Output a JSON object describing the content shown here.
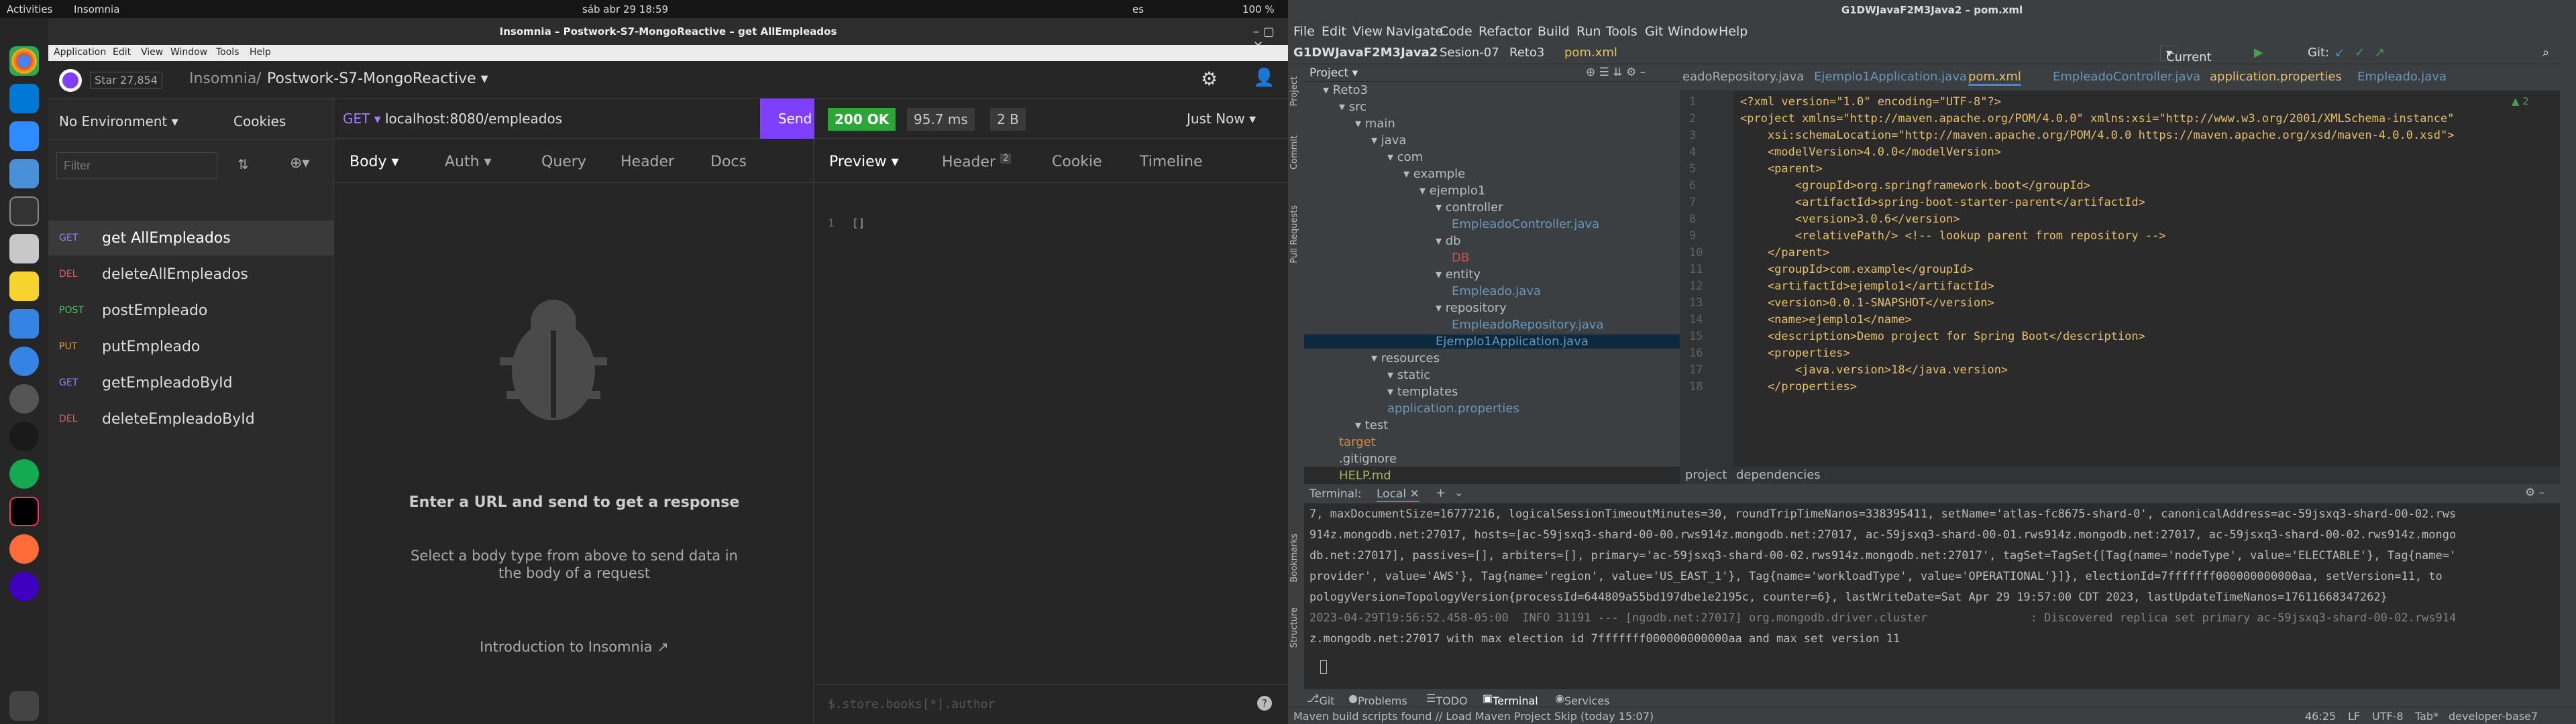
{
  "topbar": {
    "activities": "Activities",
    "app": "Insomnia",
    "clock": "sáb abr 29  18:59",
    "lang": "es",
    "battery": "100 %"
  },
  "insomnia": {
    "window_title": "Insomnia – Postwork-S7-MongoReactive – get AllEmpleados",
    "menu": [
      "Application",
      "Edit",
      "View",
      "Window",
      "Tools",
      "Help"
    ],
    "star": "Star",
    "star_count": "27,854",
    "breadcrumb_root": "Insomnia",
    "project": "Postwork-S7-MongoReactive",
    "env": "No Environment",
    "cookies": "Cookies",
    "filter_placeholder": "Filter",
    "requests": [
      {
        "method": "GET",
        "name": "get AllEmpleados"
      },
      {
        "method": "DEL",
        "name": "deleteAllEmpleados"
      },
      {
        "method": "POST",
        "name": "postEmpleado"
      },
      {
        "method": "PUT",
        "name": "putEmpleado"
      },
      {
        "method": "GET",
        "name": "getEmpleadoById"
      },
      {
        "method": "DEL",
        "name": "deleteEmpleadoById"
      }
    ],
    "url_method": "GET",
    "url": "localhost:8080/empleados",
    "send": "Send",
    "req_tabs": [
      "Body",
      "Auth",
      "Query",
      "Header",
      "Docs"
    ],
    "empty_title": "Enter a URL and send to get a response",
    "empty_sub1": "Select a body type from above to send data in",
    "empty_sub2": "the body of a request",
    "intro_link": "Introduction to Insomnia",
    "status": "200 OK",
    "time": "95.7 ms",
    "size": "2 B",
    "when": "Just Now",
    "resp_tabs": [
      "Preview",
      "Header",
      "Cookie",
      "Timeline"
    ],
    "header_count": "2",
    "body_line": "1",
    "body_text": "[]",
    "filter_expr": "$.store.books[*].author",
    "help": "?"
  },
  "ide": {
    "title": "G1DWJavaF2M3Java2 – pom.xml",
    "menu": [
      "File",
      "Edit",
      "View",
      "Navigate",
      "Code",
      "Refactor",
      "Build",
      "Run",
      "Tools",
      "Git",
      "Window",
      "Help"
    ],
    "nav": [
      "G1DWJavaF2M3Java2",
      "Sesion-07",
      "Reto3",
      "pom.xml"
    ],
    "run_config": "Current File",
    "git": "Git:",
    "project_label": "Project",
    "tree": [
      {
        "t": "Reto3",
        "d": 2,
        "c": ""
      },
      {
        "t": "src",
        "d": 3,
        "c": ""
      },
      {
        "t": "main",
        "d": 4,
        "c": ""
      },
      {
        "t": "java",
        "d": 5,
        "c": ""
      },
      {
        "t": "com",
        "d": 6,
        "c": ""
      },
      {
        "t": "example",
        "d": 7,
        "c": ""
      },
      {
        "t": "ejemplo1",
        "d": 8,
        "c": ""
      },
      {
        "t": "controller",
        "d": 9,
        "c": ""
      },
      {
        "t": "EmpleadoController.java",
        "d": 10,
        "c": "java"
      },
      {
        "t": "db",
        "d": 9,
        "c": ""
      },
      {
        "t": "DB",
        "d": 10,
        "c": "red"
      },
      {
        "t": "entity",
        "d": 9,
        "c": ""
      },
      {
        "t": "Empleado.java",
        "d": 10,
        "c": "java"
      },
      {
        "t": "repository",
        "d": 9,
        "c": ""
      },
      {
        "t": "EmpleadoRepository.java",
        "d": 10,
        "c": "java"
      },
      {
        "t": "Ejemplo1Application.java",
        "d": 9,
        "c": "java"
      },
      {
        "t": "resources",
        "d": 5,
        "c": ""
      },
      {
        "t": "static",
        "d": 6,
        "c": ""
      },
      {
        "t": "templates",
        "d": 6,
        "c": ""
      },
      {
        "t": "application.properties",
        "d": 6,
        "c": "java"
      },
      {
        "t": "test",
        "d": 4,
        "c": ""
      },
      {
        "t": "target",
        "d": 3,
        "c": "orange"
      },
      {
        "t": ".gitignore",
        "d": 3,
        "c": ""
      },
      {
        "t": "HELP.md",
        "d": 3,
        "c": "olive"
      }
    ],
    "tabs": [
      "eadoRepository.java",
      "Ejemplo1Application.java",
      "pom.xml",
      "EmpleadoController.java",
      "application.properties",
      "Empleado.java"
    ],
    "code": [
      "<?xml version=\"1.0\" encoding=\"UTF-8\"?>",
      "<project xmlns=\"http://maven.apache.org/POM/4.0.0\" xmlns:xsi=\"http://www.w3.org/2001/XMLSchema-instance\"",
      "    xsi:schemaLocation=\"http://maven.apache.org/POM/4.0.0 https://maven.apache.org/xsd/maven-4.0.0.xsd\">",
      "    <modelVersion>4.0.0</modelVersion>",
      "    <parent>",
      "        <groupId>org.springframework.boot</groupId>",
      "        <artifactId>spring-boot-starter-parent</artifactId>",
      "        <version>3.0.6</version>",
      "        <relativePath/> <!-- lookup parent from repository -->",
      "    </parent>",
      "    <groupId>com.example</groupId>",
      "    <artifactId>ejemplo1</artifactId>",
      "    <version>0.0.1-SNAPSHOT</version>",
      "    <name>ejemplo1</name>",
      "    <description>Demo project for Spring Boot</description>",
      "    <properties>",
      "        <java.version>18</java.version>",
      "    </properties>"
    ],
    "warn": "▲ 2",
    "breadcrumbs": [
      "project",
      "dependencies"
    ],
    "terminal_tab": "Terminal:",
    "terminal_local": "Local",
    "terminal": [
      "7, maxDocumentSize=16777216, logicalSessionTimeoutMinutes=30, roundTripTimeNanos=338395411, setName='atlas-fc8675-shard-0', canonicalAddress=ac-59jsxq3-shard-00-02.rws",
      "914z.mongodb.net:27017, hosts=[ac-59jsxq3-shard-00-00.rws914z.mongodb.net:27017, ac-59jsxq3-shard-00-01.rws914z.mongodb.net:27017, ac-59jsxq3-shard-00-02.rws914z.mongo",
      "db.net:27017], passives=[], arbiters=[], primary='ac-59jsxq3-shard-00-02.rws914z.mongodb.net:27017', tagSet=TagSet{[Tag{name='nodeType', value='ELECTABLE'}, Tag{name='",
      "provider', value='AWS'}, Tag{name='region', value='US_EAST_1'}, Tag{name='workloadType', value='OPERATIONAL'}]}, electionId=7fffffff000000000000aa, setVersion=11, to",
      "pologyVersion=TopologyVersion{processId=644809a55bd197dbe1e2195c, counter=6}, lastWriteDate=Sat Apr 29 19:57:00 CDT 2023, lastUpdateTimeNanos=17611668347262}",
      "2023-04-29T19:56:52.458-05:00  INFO 31191 --- [ngodb.net:27017] org.mongodb.driver.cluster               : Discovered replica set primary ac-59jsxq3-shard-00-02.rws914",
      "z.mongodb.net:27017 with max election id 7fffffff000000000000aa and max set version 11"
    ],
    "tools": [
      "Git",
      "Problems",
      "TODO",
      "Terminal",
      "Services"
    ],
    "status_msg": "Maven build scripts found // Load Maven Project   Skip (today 15:07)",
    "status_right": [
      "46:25",
      "LF",
      "UTF-8",
      "Tab*",
      "developer-base7"
    ],
    "side_labels": [
      "Project",
      "Commit",
      "Pull Requests",
      "Bookmarks",
      "Structure"
    ]
  }
}
